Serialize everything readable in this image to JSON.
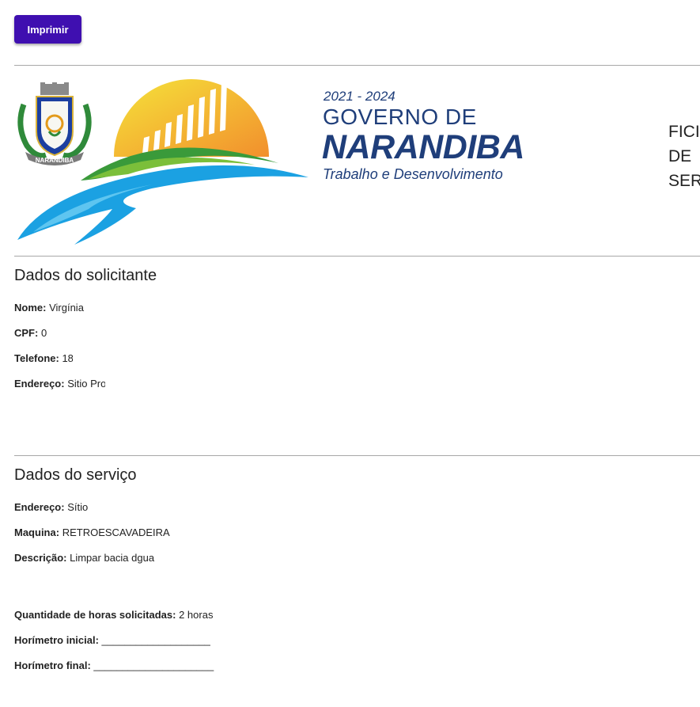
{
  "toolbar": {
    "print_label": "Imprimir"
  },
  "header": {
    "crest_text": "NARANDIBA",
    "gov_year": "2021 - 2024",
    "gov_line1": "GOVERNO DE",
    "gov_city": "NARANDIBA",
    "gov_tagline": "Trabalho e Desenvolvimento",
    "doc_title_lines": [
      "FICI",
      "DE",
      "SER"
    ]
  },
  "requester": {
    "title": "Dados do solicitante",
    "name_label": "Nome:",
    "name_value": "Virgínia",
    "cpf_label": "CPF:",
    "cpf_value": "0",
    "phone_label": "Telefone:",
    "phone_value": "18",
    "address_label": "Endereço:",
    "address_value": "Sitio Pro"
  },
  "service": {
    "title": "Dados do serviço",
    "address_label": "Endereço:",
    "address_value": "Sítio",
    "machine_label": "Maquina:",
    "machine_value": "RETROESCAVADEIRA",
    "description_label": "Descrição:",
    "description_value": "Limpar bacia dgua",
    "hours_label": "Quantidade de horas solicitadas:",
    "hours_value": "2 horas",
    "start_meter_label": "Horímetro inicial:",
    "start_meter_value": "___________________",
    "end_meter_label": "Horímetro final:",
    "end_meter_value": "_____________________"
  },
  "colors": {
    "print_button": "#3f0fb0",
    "gov_blue": "#1f3e7a",
    "sun_yellow": "#f2d43a",
    "sun_orange": "#f39a2d",
    "green": "#3a9a3a",
    "water_blue": "#1ba1e2"
  }
}
